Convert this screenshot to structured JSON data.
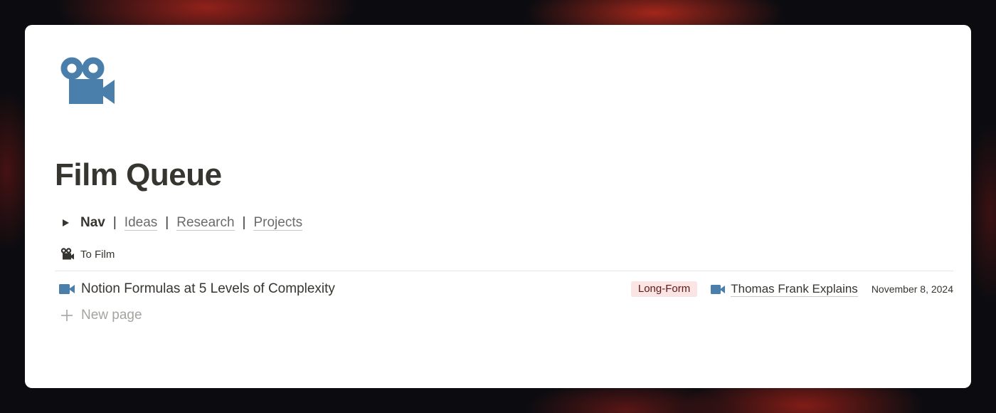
{
  "page": {
    "icon": "movie-camera-icon",
    "title": "Film Queue"
  },
  "nav": {
    "toggle_icon": "triangle-right-icon",
    "title": "Nav",
    "separator": "|",
    "links": [
      "Ideas",
      "Research",
      "Projects"
    ]
  },
  "view": {
    "icon": "movie-camera-icon",
    "name": "To Film"
  },
  "rows": [
    {
      "icon": "video-camera-icon",
      "title": "Notion Formulas at 5 Levels of Complexity",
      "tag": "Long-Form",
      "relation_icon": "video-camera-icon",
      "relation": "Thomas Frank Explains",
      "date": "November 8, 2024"
    }
  ],
  "new_page": {
    "icon": "plus-icon",
    "label": "New page"
  },
  "colors": {
    "accent_blue": "#4a7fab",
    "tag_bg": "#fbe4e4",
    "tag_text": "#5d1715",
    "text": "#37352f",
    "muted": "#a5a4a0"
  }
}
